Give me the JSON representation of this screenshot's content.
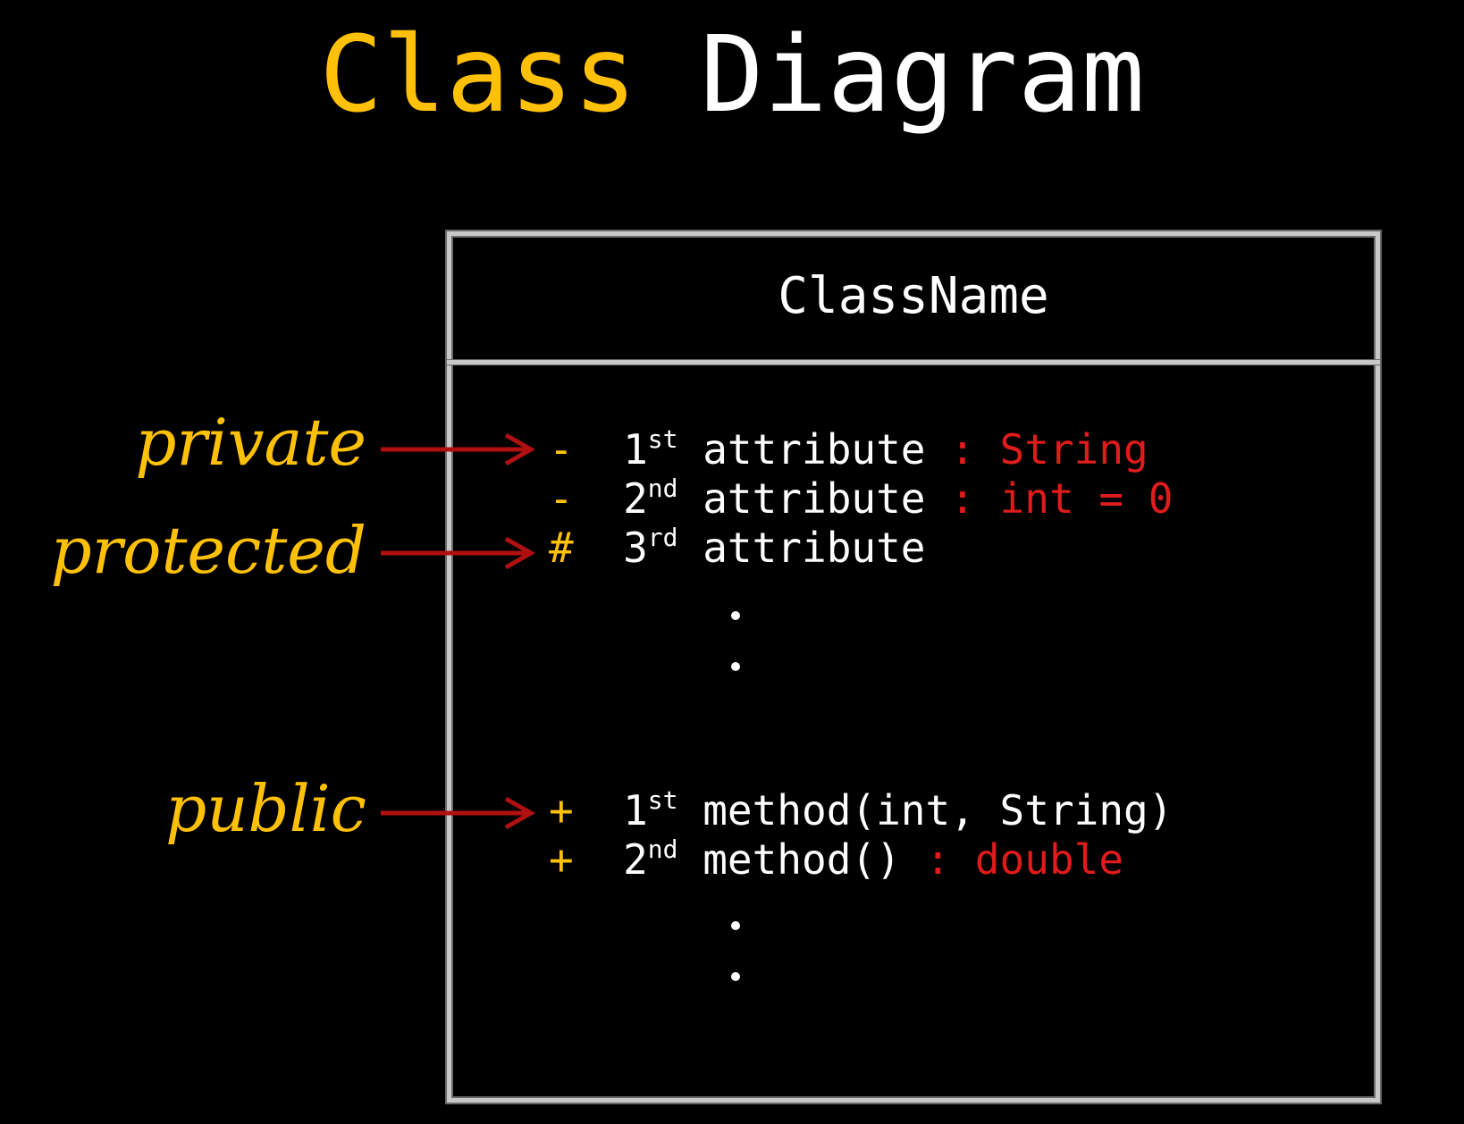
{
  "title": {
    "word1": "Class",
    "word2": "Diagram"
  },
  "class_box": {
    "name": "ClassName",
    "attributes": [
      {
        "symbol": "-",
        "ordinal": "1",
        "ordinal_suffix": "st",
        "text": "attribute",
        "type_text": " : String"
      },
      {
        "symbol": "-",
        "ordinal": "2",
        "ordinal_suffix": "nd",
        "text": "attribute",
        "type_text": " : int = 0"
      },
      {
        "symbol": "#",
        "ordinal": "3",
        "ordinal_suffix": "rd",
        "text": "attribute",
        "type_text": ""
      }
    ],
    "methods": [
      {
        "symbol": "+",
        "ordinal": "1",
        "ordinal_suffix": "st",
        "text": "method(int, String)",
        "type_text": ""
      },
      {
        "symbol": "+",
        "ordinal": "2",
        "ordinal_suffix": "nd",
        "text": "method()",
        "type_text": " : double"
      }
    ]
  },
  "labels": {
    "private": "private",
    "protected": "protected",
    "public": "public"
  },
  "colors": {
    "background": "#000000",
    "accent_yellow": "#ffc107",
    "type_red": "#e01b1b",
    "arrow_red": "#b01010",
    "text_white": "#ffffff",
    "border_gray": "#c8c8c8"
  }
}
